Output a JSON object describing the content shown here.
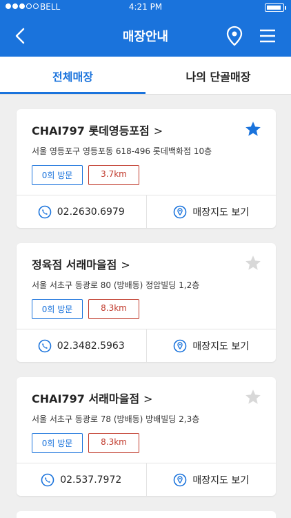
{
  "status": {
    "carrier": "BELL",
    "time": "4:21 PM"
  },
  "header": {
    "title": "매장안내"
  },
  "tabs": [
    {
      "label": "전체매장",
      "active": true
    },
    {
      "label": "나의 단골매장",
      "active": false
    }
  ],
  "stores": [
    {
      "name": "CHAI797 롯데영등포점",
      "favorite": true,
      "address": "서울 영등포구 영등포동 618-496 롯데백화점 10층",
      "visits": "0회 방문",
      "distance": "3.7km",
      "phone": "02.2630.6979",
      "map_label": "매장지도 보기"
    },
    {
      "name": "정육점 서래마을점",
      "favorite": false,
      "address": "서울 서초구 동광로 80 (방배동) 정암빌딩 1,2층",
      "visits": "0회 방문",
      "distance": "8.3km",
      "phone": "02.3482.5963",
      "map_label": "매장지도 보기"
    },
    {
      "name": "CHAI797 서래마을점",
      "favorite": false,
      "address": "서울 서초구 동광로 78 (방배동) 방배빌딩 2,3층",
      "visits": "0회 방문",
      "distance": "8.3km",
      "phone": "02.537.7972",
      "map_label": "매장지도 보기"
    }
  ],
  "colors": {
    "primary": "#1a73dc",
    "distance": "#c0392b",
    "star_active": "#1a73dc",
    "star_inactive": "#d8d8d8"
  },
  "icons": {
    "back": "chevron-left-icon",
    "location": "location-pin-icon",
    "menu": "hamburger-menu-icon",
    "phone": "phone-icon",
    "map": "map-pin-icon",
    "favorite": "star-icon"
  }
}
